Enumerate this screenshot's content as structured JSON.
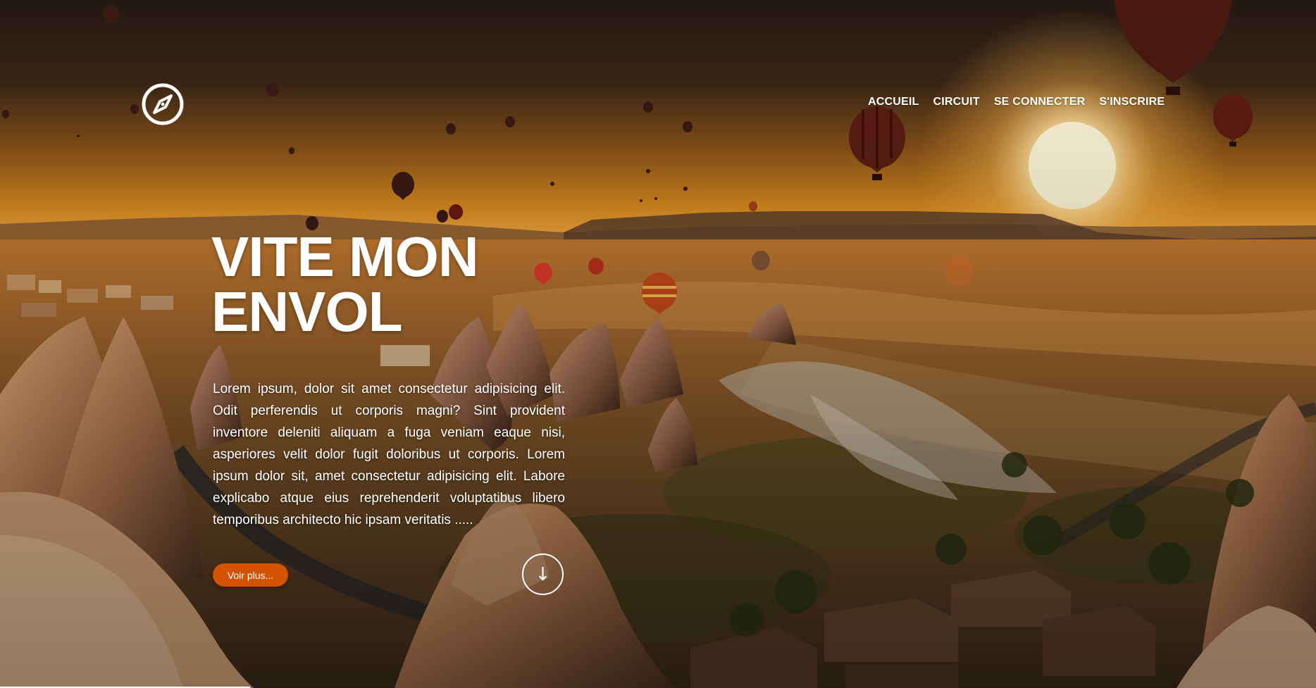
{
  "logo": {
    "icon": "compass-icon"
  },
  "nav": {
    "items": [
      {
        "label": "ACCUEIL"
      },
      {
        "label": "CIRCUIT"
      },
      {
        "label": "SE CONNECTER"
      },
      {
        "label": "S'INSCRIRE"
      }
    ]
  },
  "hero": {
    "title_line1": "VITE MON",
    "title_line2": "ENVOL",
    "text": "Lorem ipsum, dolor sit amet consectetur adipisicing elit. Odit perferendis ut corporis magni? Sint provident inventore deleniti aliquam a fuga veniam eaque nisi, asperiores velit dolor fugit doloribus ut corporis. Lorem ipsum dolor sit, amet consectetur adipisicing elit. Labore explicabo atque eius reprehenderit voluptatibus libero temporibus architecto hic ipsam veritatis .....",
    "cta_label": "Voir plus...",
    "scroll_icon": "arrow-down-icon",
    "scroll_glyph": "↓"
  },
  "colors": {
    "accent": "#d35400",
    "text": "#ffffff",
    "sky_top": "#241a14",
    "sky_horizon": "#e0901e",
    "sun": "#fff2c8"
  }
}
